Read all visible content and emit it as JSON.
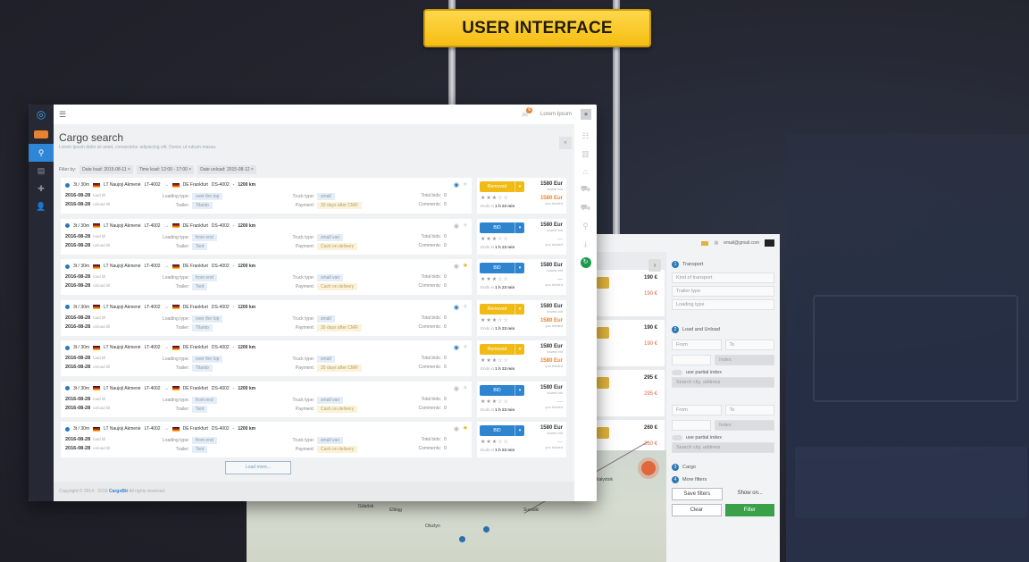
{
  "sign": {
    "title": "USER INTERFACE"
  },
  "app": {
    "topbar": {
      "notifications": "6",
      "username": "Lorem Ipsum"
    },
    "header": {
      "title": "Cargo search",
      "subtitle": "Lorem ipsum dolor sit amet, consectetur adipiscing elit. Donec ut rutrum massa."
    },
    "filterbar": {
      "label": "Filter by:",
      "chips": [
        "Date load: 2015-08-11 ×",
        "Time load: 12:00 - 17:00 ×",
        "Date unload: 2015-08-12 ×"
      ]
    },
    "sidebar": {
      "items": [
        "logo",
        "cargo",
        "search",
        "documents",
        "add",
        "user"
      ]
    },
    "rows": [
      {
        "weight": "3t / 30m",
        "from": "LT Naujoji Akmenė",
        "from_code": "LT-4002",
        "to": "DE Frankfurt",
        "to_code": "DS-4002",
        "distance": "1200 km",
        "date_load": "2016-08-28",
        "load_label": "load till",
        "date_unload": "2016-08-28",
        "unload_label": "unload till",
        "loading_type": "over the top",
        "trailer": "Tilanto",
        "truck_type": "small",
        "payment": "30 days after CMR",
        "total_bids": "0",
        "comments": "0",
        "bid_label": "Removed",
        "bid_style": "yellow",
        "price": "1580 Eur",
        "price_note": "lowest bid",
        "my_price": "1580 Eur",
        "my_note": "you bidded",
        "ends": "1 h 23 min",
        "eye": true,
        "starred": false
      },
      {
        "weight": "3t / 30m",
        "from": "LT Naujoji Akmenė",
        "from_code": "LT-4002",
        "to": "DE Frankfurt",
        "to_code": "DS-4002",
        "distance": "1200 km",
        "date_load": "2016-08-28",
        "load_label": "load till",
        "date_unload": "2016-08-28",
        "unload_label": "unload till",
        "loading_type": "from end",
        "trailer": "Tent",
        "truck_type": "small  van",
        "payment": "Cash on delivery",
        "total_bids": "0",
        "comments": "0",
        "bid_label": "BID",
        "bid_style": "blue",
        "price": "1580 Eur",
        "price_note": "lowest bid",
        "my_price": "—",
        "my_note": "you bidded",
        "ends": "1 h 23 min",
        "eye": false,
        "starred": false
      },
      {
        "weight": "3t / 30m",
        "from": "LT Naujoji Akmenė",
        "from_code": "LT-4002",
        "to": "DE Frankfurt",
        "to_code": "DS-4002",
        "distance": "1200 km",
        "date_load": "2016-08-28",
        "load_label": "load till",
        "date_unload": "2016-08-28",
        "unload_label": "unload till",
        "loading_type": "from end",
        "trailer": "Tent",
        "truck_type": "small  van",
        "payment": "Cash on delivery",
        "total_bids": "0",
        "comments": "0",
        "bid_label": "BID",
        "bid_style": "blue",
        "price": "1580 Eur",
        "price_note": "lowest bid",
        "my_price": "—",
        "my_note": "you bidded",
        "ends": "1 h 23 min",
        "eye": false,
        "starred": true
      },
      {
        "weight": "3t / 30m",
        "from": "LT Naujoji Akmenė",
        "from_code": "LT-4002",
        "to": "DE Frankfurt",
        "to_code": "DS-4002",
        "distance": "1200 km",
        "date_load": "2016-08-28",
        "load_label": "load till",
        "date_unload": "2016-08-28",
        "unload_label": "unload till",
        "loading_type": "over the top",
        "trailer": "Tilanto",
        "truck_type": "small",
        "payment": "30 days after CMR",
        "total_bids": "0",
        "comments": "0",
        "bid_label": "Removed",
        "bid_style": "yellow",
        "price": "1580 Eur",
        "price_note": "lowest bid",
        "my_price": "1580 Eur",
        "my_note": "you bidded",
        "ends": "1 h 23 min",
        "eye": true,
        "starred": false
      },
      {
        "weight": "3t / 30m",
        "from": "LT Naujoji Akmenė",
        "from_code": "LT-4002",
        "to": "DE Frankfurt",
        "to_code": "DS-4002",
        "distance": "1200 km",
        "date_load": "2016-08-28",
        "load_label": "load till",
        "date_unload": "2016-08-28",
        "unload_label": "unload till",
        "loading_type": "over the top",
        "trailer": "Tilanto",
        "truck_type": "small",
        "payment": "30 days after CMR",
        "total_bids": "0",
        "comments": "0",
        "bid_label": "Removed",
        "bid_style": "yellow",
        "price": "1580 Eur",
        "price_note": "lowest bid",
        "my_price": "1580 Eur",
        "my_note": "you bidded",
        "ends": "1 h 23 min",
        "eye": true,
        "starred": false
      },
      {
        "weight": "3t / 30m",
        "from": "LT Naujoji Akmenė",
        "from_code": "LT-4002",
        "to": "DE Frankfurt",
        "to_code": "DS-4002",
        "distance": "1200 km",
        "date_load": "2016-08-28",
        "load_label": "load till",
        "date_unload": "2016-08-28",
        "unload_label": "unload till",
        "loading_type": "from end",
        "trailer": "Tent",
        "truck_type": "small  van",
        "payment": "Cash on delivery",
        "total_bids": "0",
        "comments": "0",
        "bid_label": "BID",
        "bid_style": "blue",
        "price": "1580 Eur",
        "price_note": "lowest bid",
        "my_price": "—",
        "my_note": "you bidded",
        "ends": "1 h 23 min",
        "eye": false,
        "starred": false
      },
      {
        "weight": "3t / 30m",
        "from": "LT Naujoji Akmenė",
        "from_code": "LT-4002",
        "to": "DE Frankfurt",
        "to_code": "DS-4002",
        "distance": "1200 km",
        "date_load": "2016-08-28",
        "load_label": "load till",
        "date_unload": "2016-08-28",
        "unload_label": "unload till",
        "loading_type": "from end",
        "trailer": "Tent",
        "truck_type": "small  van",
        "payment": "Cash on delivery",
        "total_bids": "0",
        "comments": "0",
        "bid_label": "BID",
        "bid_style": "blue",
        "price": "1580 Eur",
        "price_note": "lowest bid",
        "my_price": "—",
        "my_note": "you bidded",
        "ends": "1 h 23 min",
        "eye": false,
        "starred": true
      }
    ],
    "labels": {
      "loading_type": "Loading type:",
      "trailer": "Trailer:",
      "truck_type": "Truck type:",
      "payment": "Payment:",
      "total_bids": "Total bids:",
      "comments": "Comments:",
      "ends_in": "Ends in"
    },
    "load_more": "Load more...",
    "footer": {
      "prefix": "Copyright © 2014 - 2016",
      "brand": "CargoBit",
      "suffix": "All rights reserved."
    }
  },
  "back_window": {
    "email": "email@gmail.com",
    "results": [
      {
        "price": "190 €",
        "my": "190 €"
      },
      {
        "price": "190 €",
        "my": "190 €"
      },
      {
        "price": "295 €",
        "my": "295 €"
      },
      {
        "price": "260 €",
        "my": "260 €"
      }
    ],
    "filters": {
      "sections": [
        {
          "num": "1",
          "label": "Transport"
        },
        {
          "num": "2",
          "label": "Load and Unload"
        },
        {
          "num": "3",
          "label": "Cargo"
        },
        {
          "num": "4",
          "label": "More filters"
        }
      ],
      "kind_of_transport": "Kind of transport",
      "trailer_type": "Trailer type",
      "loading_type": "Loading type",
      "from": "From",
      "to": "To",
      "index": "Index",
      "partial_index": "use partial index",
      "search_city": "Search city, address",
      "save_filters": "Save filters",
      "show_on": "Show on...",
      "clear": "Clear",
      "filter": "Filter"
    },
    "map_labels": [
      "Gdańsk",
      "Olsztyn",
      "Elbląg",
      "Suwałki",
      "Białystok"
    ]
  }
}
